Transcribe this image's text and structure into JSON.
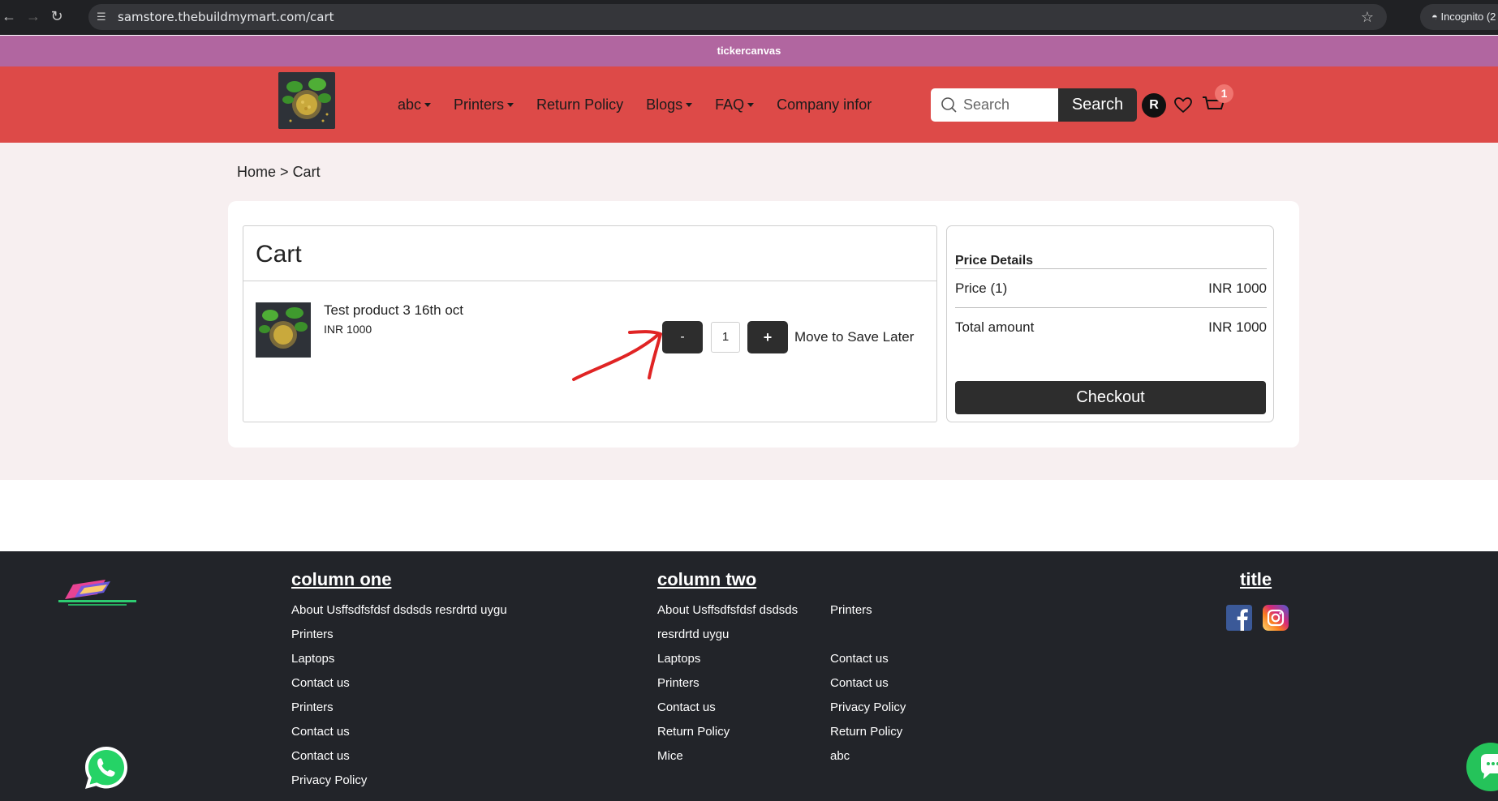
{
  "browser": {
    "url": "samstore.thebuildmymart.com/cart",
    "profile_label": "Incognito (2"
  },
  "ticker": {
    "text": "tickercanvas"
  },
  "header": {
    "nav": [
      {
        "label": "abc",
        "has_dropdown": true
      },
      {
        "label": "Printers",
        "has_dropdown": true
      },
      {
        "label": "Return Policy",
        "has_dropdown": false
      },
      {
        "label": "Blogs",
        "has_dropdown": true
      },
      {
        "label": "FAQ",
        "has_dropdown": true
      },
      {
        "label": "Company infor",
        "has_dropdown": false
      }
    ],
    "search_placeholder": "Search",
    "search_button": "Search",
    "avatar_letter": "R",
    "cart_count": "1"
  },
  "breadcrumb": {
    "home": "Home",
    "separator": ">",
    "current": "Cart"
  },
  "cart": {
    "title": "Cart",
    "items": [
      {
        "name": "Test product 3 16th oct",
        "price": "INR 1000",
        "quantity": "1"
      }
    ],
    "minus_label": "-",
    "plus_label": "+",
    "save_later_label": "Move to Save Later"
  },
  "price_details": {
    "title": "Price Details",
    "price_label": "Price (1)",
    "price_value": "INR 1000",
    "total_label": "Total amount",
    "total_value": "INR 1000",
    "checkout_label": "Checkout"
  },
  "footer": {
    "column_one": {
      "title": "column one",
      "links": [
        "About Usffsdfsfdsf dsdsds resrdrtd uygu",
        "Printers",
        "Laptops",
        "Contact us",
        "Printers",
        "Contact us",
        "Contact us",
        "Privacy Policy"
      ]
    },
    "column_two": {
      "title": "column two",
      "links_a": [
        "About Usffsdfsfdsf dsdsds",
        "resrdrtd uygu",
        "Laptops",
        "Printers",
        "Contact us",
        "Return Policy",
        "Mice"
      ],
      "links_b": [
        "Printers",
        "Contact us",
        "Contact us",
        "Privacy Policy",
        "Return Policy",
        "abc"
      ]
    },
    "column_three": {
      "title": "title"
    }
  },
  "colors": {
    "ticker": "#b166a0",
    "header": "#dd4a48",
    "page_bg": "#f7eff0",
    "dark_button": "#2d2d2d",
    "footer": "#222429",
    "annotation": "#e02424"
  }
}
